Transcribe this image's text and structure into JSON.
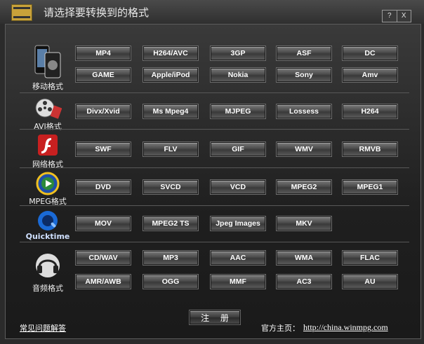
{
  "window": {
    "title": "请选择要转换到的格式",
    "help_btn": "?",
    "close_btn": "X"
  },
  "categories": [
    {
      "label": "移动格式",
      "icon": "mobile-phone-icon",
      "rows": [
        [
          "MP4",
          "H264/AVC",
          "3GP",
          "ASF",
          "DC"
        ],
        [
          "GAME",
          "Apple/iPod",
          "Nokia",
          "Sony",
          "Amv"
        ]
      ]
    },
    {
      "label": "AVI格式",
      "icon": "film-reel-icon",
      "rows": [
        [
          "Divx/Xvid",
          "Ms Mpeg4",
          "MJPEG",
          "Lossess",
          "H264"
        ]
      ]
    },
    {
      "label": "网络格式",
      "icon": "flash-icon",
      "rows": [
        [
          "SWF",
          "FLV",
          "GIF",
          "WMV",
          "RMVB"
        ]
      ]
    },
    {
      "label": "MPEG格式",
      "icon": "media-player-icon",
      "rows": [
        [
          "DVD",
          "SVCD",
          "VCD",
          "MPEG2",
          "MPEG1"
        ]
      ]
    },
    {
      "label": "Quicktime",
      "icon": "quicktime-icon",
      "rows": [
        [
          "MOV",
          "MPEG2 TS",
          "Jpeg Images",
          "MKV"
        ]
      ]
    },
    {
      "label": "音频格式",
      "icon": "headphones-icon",
      "rows": [
        [
          "CD/WAV",
          "MP3",
          "AAC",
          "WMA",
          "FLAC"
        ],
        [
          "AMR/AWB",
          "OGG",
          "MMF",
          "AC3",
          "AU"
        ]
      ]
    }
  ],
  "footer": {
    "faq_link": "常见问题解答",
    "register_btn": "注 册",
    "homepage_label": "官方主页：",
    "homepage_url": "http://china.winmpg.com"
  }
}
